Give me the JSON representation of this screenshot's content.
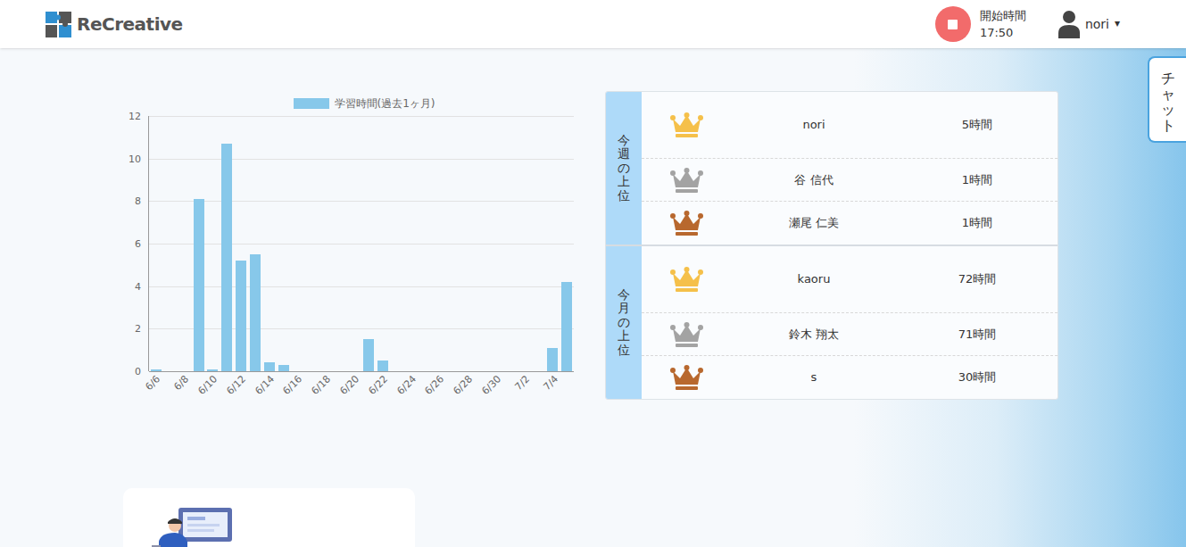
{
  "header": {
    "logo": "ReCreative",
    "timer": {
      "label": "開始時間",
      "time": "17:50",
      "running": true
    },
    "user": {
      "name": "nori",
      "caret": "▾"
    }
  },
  "chat_tab": {
    "label": "チャット"
  },
  "chart": {
    "legend": "学習時間(過去1ヶ月)",
    "y_ticks": [
      "0",
      "2",
      "4",
      "6",
      "8",
      "10",
      "12"
    ],
    "x_labels": [
      "6/6",
      "6/8",
      "6/10",
      "6/12",
      "6/14",
      "6/16",
      "6/18",
      "6/20",
      "6/22",
      "6/24",
      "6/26",
      "6/28",
      "6/30",
      "7/2",
      "7/4"
    ],
    "values": [
      0.1,
      0,
      0,
      8.1,
      0.1,
      10.7,
      5.2,
      5.5,
      0.4,
      0.3,
      0,
      0,
      0,
      0,
      0,
      1.5,
      0.5,
      0,
      0,
      0,
      0,
      0,
      0,
      0,
      0,
      0,
      0,
      0,
      1.1,
      4.2
    ]
  },
  "ranking": [
    {
      "label": "今週の上位",
      "rows": [
        {
          "name": "nori",
          "hours": "5時間",
          "color": "#f5c04a"
        },
        {
          "name": "谷 信代",
          "hours": "1時間",
          "color": "#a3a3a3"
        },
        {
          "name": "瀬尾 仁美",
          "hours": "1時間",
          "color": "#b8682e"
        }
      ]
    },
    {
      "label": "今月の上位",
      "rows": [
        {
          "name": "kaoru",
          "hours": "72時間",
          "color": "#f5c04a"
        },
        {
          "name": "鈴木 翔太",
          "hours": "71時間",
          "color": "#a3a3a3"
        },
        {
          "name": "s",
          "hours": "30時間",
          "color": "#b8682e"
        }
      ]
    }
  ]
}
